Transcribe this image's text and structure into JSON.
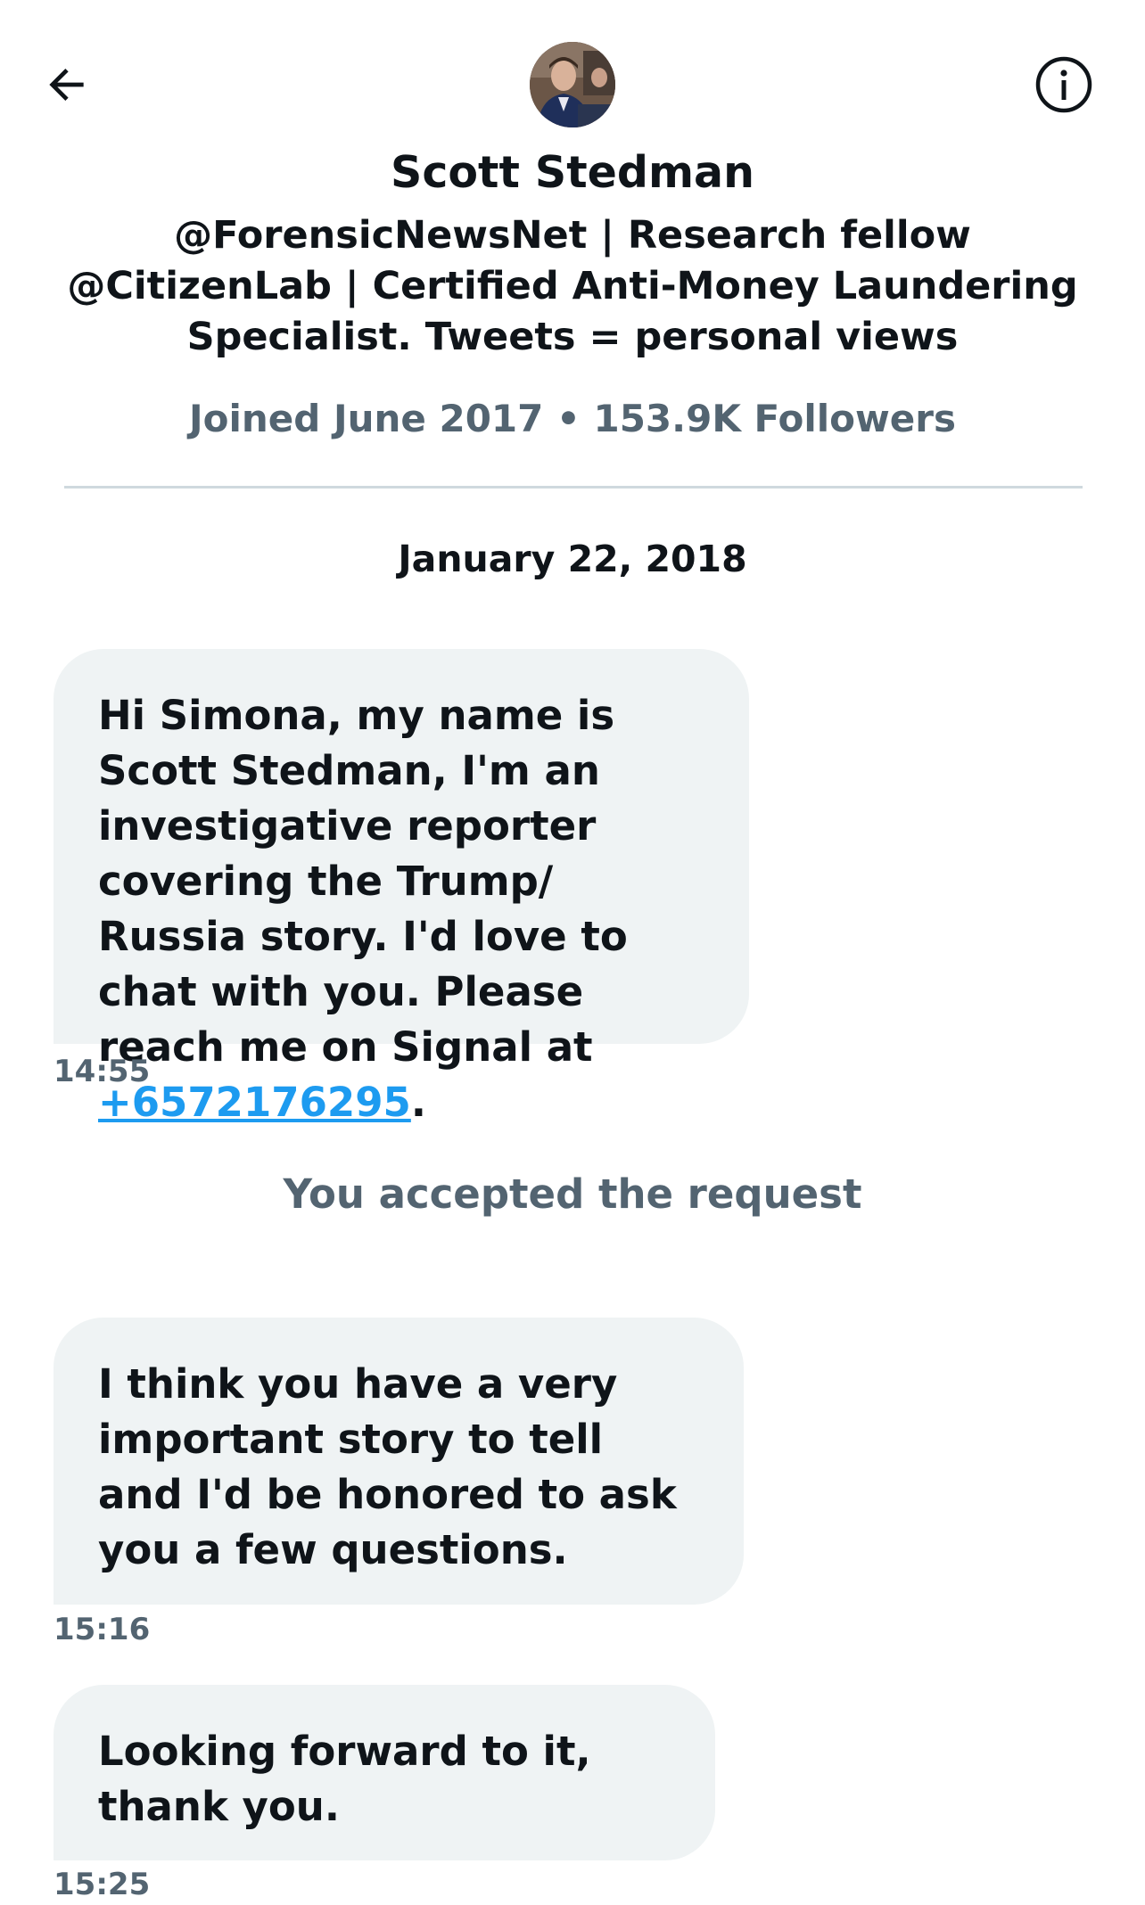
{
  "header": {
    "back_icon": "arrow-left-icon",
    "info_icon": "info-circle-icon",
    "name": "Scott Stedman",
    "bio": "@ForensicNewsNet | Research fellow @CitizenLab | Certified Anti-Money Laundering Specialist. Tweets = personal views",
    "meta": "Joined June 2017 • 153.9K Followers"
  },
  "conversation": {
    "date": "January 22, 2018",
    "messages": [
      {
        "text_before_link": "Hi Simona, my name is Scott Stedman, I'm an investigative reporter covering the Trump/ Russia story. I'd love to chat with you. Please reach me on Signal at ",
        "link": "+6572176295",
        "text_after_link": ".",
        "time": "14:55"
      },
      {
        "text": "I think you have a very important story to tell and I'd be honored to ask you a few questions.",
        "time": "15:16"
      },
      {
        "text": "Looking forward to it, thank you.",
        "time": "15:25"
      }
    ],
    "system_note": "You accepted the request"
  },
  "colors": {
    "link": "#1d9bf0",
    "bubble_bg": "#eff3f4",
    "secondary_text": "#536471",
    "divider": "#cfd9de"
  }
}
